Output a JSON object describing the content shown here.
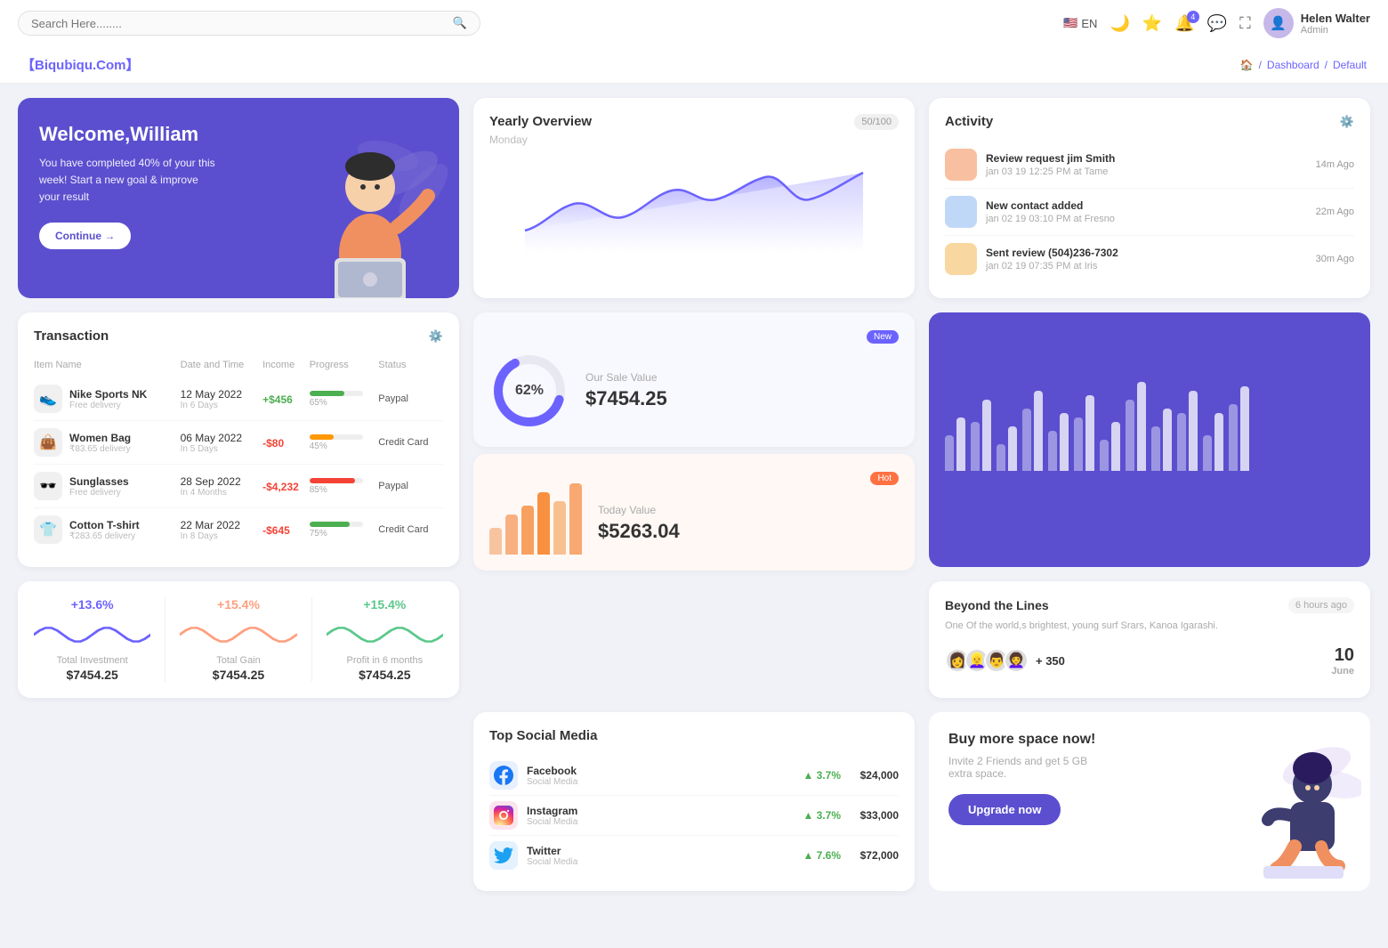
{
  "topnav": {
    "search_placeholder": "Search Here........",
    "lang": "EN",
    "bell_count": "4",
    "user": {
      "name": "Helen Walter",
      "role": "Admin"
    }
  },
  "breadcrumb": {
    "brand": "【Biqubiqu.Com】",
    "path": [
      "Dashboard",
      "Default"
    ]
  },
  "welcome": {
    "title": "Welcome,William",
    "subtitle": "You have completed 40% of your this week! Start a new goal & improve your result",
    "button": "Continue →"
  },
  "overview": {
    "title": "Yearly Overview",
    "day": "Monday",
    "badge": "50/100"
  },
  "activity": {
    "title": "Activity",
    "items": [
      {
        "title": "Review request jim Smith",
        "sub": "jan 03 19 12:25 PM at Tame",
        "time": "14m Ago",
        "color": "#f8c0a0"
      },
      {
        "title": "New contact added",
        "sub": "jan 02 19 03:10 PM at Fresno",
        "time": "22m Ago",
        "color": "#c0d8f8"
      },
      {
        "title": "Sent review (504)236-7302",
        "sub": "jan 02 19 07:35 PM at Iris",
        "time": "30m Ago",
        "color": "#f8d8a0"
      }
    ]
  },
  "transaction": {
    "title": "Transaction",
    "columns": [
      "Item Name",
      "Date and Time",
      "Income",
      "Progress",
      "Status"
    ],
    "rows": [
      {
        "icon": "👟",
        "name": "Nike Sports NK",
        "sub": "Free delivery",
        "date": "12 May 2022",
        "period": "In 6 Days",
        "income": "+$456",
        "positive": true,
        "progress": 65,
        "progress_color": "#4caf50",
        "status": "Paypal"
      },
      {
        "icon": "👜",
        "name": "Women Bag",
        "sub": "₹83.65 delivery",
        "date": "06 May 2022",
        "period": "In 5 Days",
        "income": "-$80",
        "positive": false,
        "progress": 45,
        "progress_color": "#ff9800",
        "status": "Credit Card"
      },
      {
        "icon": "🕶️",
        "name": "Sunglasses",
        "sub": "Free delivery",
        "date": "28 Sep 2022",
        "period": "In 4 Months",
        "income": "-$4,232",
        "positive": false,
        "progress": 85,
        "progress_color": "#f44336",
        "status": "Paypal"
      },
      {
        "icon": "👕",
        "name": "Cotton T-shirt",
        "sub": "₹283.65 delivery",
        "date": "22 Mar 2022",
        "period": "In 8 Days",
        "income": "-$645",
        "positive": false,
        "progress": 75,
        "progress_color": "#4caf50",
        "status": "Credit Card"
      }
    ]
  },
  "sale_top": {
    "badge": "New",
    "percent": "62%",
    "title": "Our Sale Value",
    "value": "$7454.25",
    "donut_pct": 62
  },
  "sale_bottom": {
    "badge": "Hot",
    "title": "Today Value",
    "value": "$5263.04",
    "bars": [
      30,
      45,
      55,
      70,
      60,
      80
    ]
  },
  "big_chart": {
    "groups": [
      [
        40,
        60
      ],
      [
        55,
        80
      ],
      [
        30,
        50
      ],
      [
        70,
        90
      ],
      [
        45,
        65
      ],
      [
        60,
        85
      ],
      [
        35,
        55
      ],
      [
        80,
        100
      ],
      [
        50,
        70
      ],
      [
        65,
        90
      ],
      [
        40,
        65
      ],
      [
        75,
        95
      ]
    ]
  },
  "beyond": {
    "title": "Beyond the Lines",
    "time": "6 hours ago",
    "desc": "One Of the world,s brightest, young surf Srars, Kanoa Igarashi.",
    "plus_count": "+ 350",
    "date": "10",
    "month": "June",
    "avatars": [
      "👩",
      "👱‍♀️",
      "👨",
      "👩‍🦱"
    ]
  },
  "stats": [
    {
      "pct": "+13.6%",
      "label": "Total Investment",
      "value": "$7454.25",
      "color": "#6c63ff"
    },
    {
      "pct": "+15.4%",
      "label": "Total Gain",
      "value": "$7454.25",
      "color": "#ff9f7f"
    },
    {
      "pct": "+15.4%",
      "label": "Profit in 6 months",
      "value": "$7454.25",
      "color": "#5bc88a"
    }
  ],
  "social": {
    "title": "Top Social Media",
    "items": [
      {
        "name": "Facebook",
        "sub": "Social Media",
        "pct": "3.7%",
        "val": "$24,000",
        "icon": "𝔽",
        "bg": "#e8f0fe"
      },
      {
        "name": "Instagram",
        "sub": "Social Media",
        "pct": "3.7%",
        "val": "$33,000",
        "icon": "📸",
        "bg": "#fce4ec"
      },
      {
        "name": "Twitter",
        "sub": "Social Media",
        "pct": "7.6%",
        "val": "$72,000",
        "icon": "🐦",
        "bg": "#e3f2fd"
      }
    ]
  },
  "buy_space": {
    "title": "Buy more space now!",
    "desc": "Invite 2 Friends and get 5 GB extra space.",
    "button": "Upgrade now"
  }
}
